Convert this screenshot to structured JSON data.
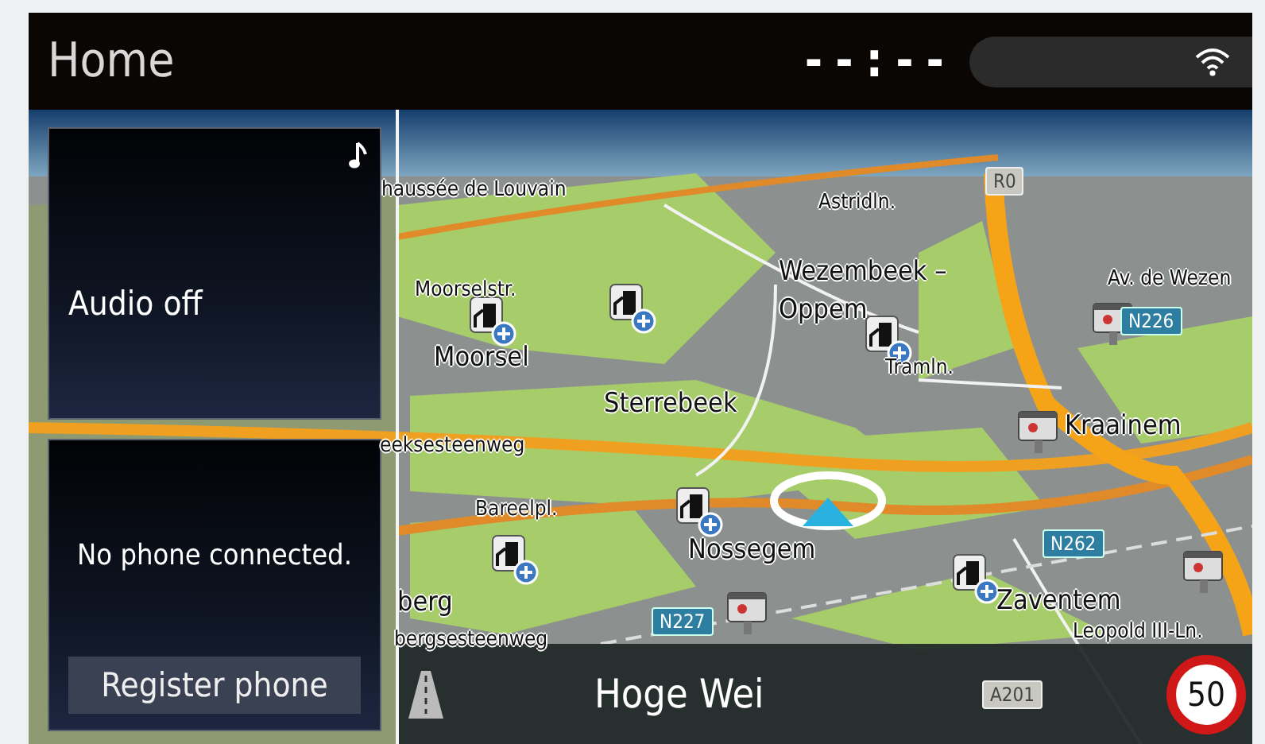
{
  "header": {
    "title": "Home",
    "clock": "--:--"
  },
  "audio_panel": {
    "text": "Audio off"
  },
  "phone_panel": {
    "text": "No phone connected.",
    "button": "Register phone"
  },
  "map": {
    "labels": [
      {
        "text": "haussée de Louvain",
        "kind": "street"
      },
      {
        "text": "Astridln.",
        "kind": "street"
      },
      {
        "text": "Wezembeek –",
        "kind": "town"
      },
      {
        "text": "Oppem",
        "kind": "town"
      },
      {
        "text": "Moorselstr.",
        "kind": "street"
      },
      {
        "text": "Moorsel",
        "kind": "town"
      },
      {
        "text": "Tramln.",
        "kind": "street"
      },
      {
        "text": "Av. de Wezen",
        "kind": "street"
      },
      {
        "text": "Sterrebeek",
        "kind": "town"
      },
      {
        "text": "Kraainem",
        "kind": "town"
      },
      {
        "text": "eeksesteenweg",
        "kind": "street"
      },
      {
        "text": "Bareelpl.",
        "kind": "street"
      },
      {
        "text": "Nossegem",
        "kind": "town"
      },
      {
        "text": "Zaventem",
        "kind": "town"
      },
      {
        "text": "berg",
        "kind": "town"
      },
      {
        "text": "bergsesteenweg",
        "kind": "street"
      },
      {
        "text": "Leopold III-Ln.",
        "kind": "street"
      }
    ],
    "shields": [
      {
        "text": "R0",
        "kind": "ring"
      },
      {
        "text": "N226",
        "kind": "national"
      },
      {
        "text": "N262",
        "kind": "national"
      },
      {
        "text": "N227",
        "kind": "national"
      },
      {
        "text": "A201",
        "kind": "ring"
      }
    ]
  },
  "guidance_bar": {
    "street": "Hoge Wei",
    "speed_limit": "50"
  }
}
